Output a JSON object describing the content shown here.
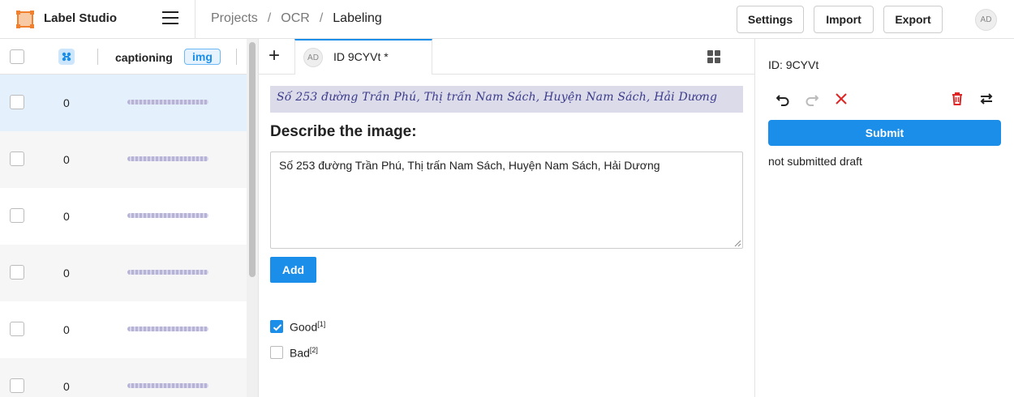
{
  "app": {
    "name": "Label Studio"
  },
  "breadcrumb": {
    "items": [
      "Projects",
      "OCR"
    ],
    "current": "Labeling"
  },
  "toolbar": {
    "settings_label": "Settings",
    "import_label": "Import",
    "export_label": "Export"
  },
  "user": {
    "initials": "AD"
  },
  "task_list": {
    "columns": {
      "caption": "captioning",
      "image": "img"
    },
    "rows": [
      {
        "count": "0",
        "selected": true
      },
      {
        "count": "0"
      },
      {
        "count": "0"
      },
      {
        "count": "0"
      },
      {
        "count": "0"
      },
      {
        "count": "0"
      }
    ]
  },
  "labeling": {
    "tab_label": "ID 9CYVt *",
    "tab_avatar": "AD",
    "image_text": "Số 253 đường Trần Phú, Thị trấn Nam Sách, Huyện Nam Sách, Hải Dương",
    "prompt": "Describe the image:",
    "text_value": "Số 253 đường Trần Phú, Thị trấn Nam Sách, Huyện Nam Sách, Hải Dương",
    "add_label": "Add",
    "choices": [
      {
        "label": "Good",
        "hotkey": "[1]",
        "checked": true
      },
      {
        "label": "Bad",
        "hotkey": "[2]",
        "checked": false
      }
    ]
  },
  "annotation_panel": {
    "id_label": "ID: 9CYVt",
    "submit_label": "Submit",
    "status": "not submitted draft"
  },
  "colors": {
    "accent": "#1a8ee8",
    "danger": "#e02424",
    "brand_orange": "#f07f2e"
  }
}
